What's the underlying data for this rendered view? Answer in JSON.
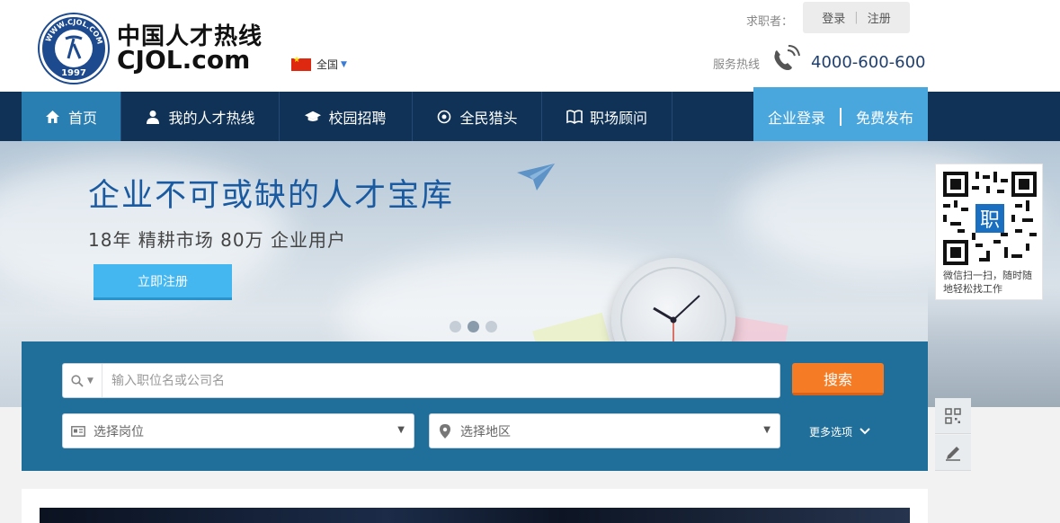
{
  "header": {
    "logo_cn": "中国人才热线",
    "logo_en": "CJOL.com",
    "logo_seal_ring": "WWW.CJOL.COM",
    "logo_seal_year": "1997",
    "region": "全国",
    "seeker_label": "求职者：",
    "login": "登录",
    "register": "注册",
    "hotline_label": "服务热线",
    "hotline_number": "4000-600-600"
  },
  "nav": {
    "items": [
      {
        "label": "首页",
        "icon": "home-icon"
      },
      {
        "label": "我的人才热线",
        "icon": "user-icon"
      },
      {
        "label": "校园招聘",
        "icon": "graduation-cap-icon"
      },
      {
        "label": "全民猎头",
        "icon": "target-icon"
      },
      {
        "label": "职场顾问",
        "icon": "book-icon"
      }
    ],
    "active_index": 0,
    "enterprise_login": "企业登录",
    "free_post": "免费发布"
  },
  "banner": {
    "title": "企业不可或缺的人才宝库",
    "subtitle": "18年 精耕市场   80万 企业用户",
    "register_button": "立即注册",
    "slide_count": 3,
    "active_slide": 1
  },
  "qr": {
    "caption": "微信扫一扫，随时随地轻松找工作",
    "center_glyph": "职"
  },
  "search": {
    "keyword_placeholder": "输入职位名或公司名",
    "search_button": "搜索",
    "position_placeholder": "选择岗位",
    "location_placeholder": "选择地区",
    "more_options": "更多选项"
  },
  "colors": {
    "nav_bg": "#0f3256",
    "nav_active": "#2a7fb2",
    "enterprise_bg": "#4aa7de",
    "search_panel": "#1f6f9a",
    "search_button": "#f57c24",
    "banner_title": "#1a5aa0"
  }
}
